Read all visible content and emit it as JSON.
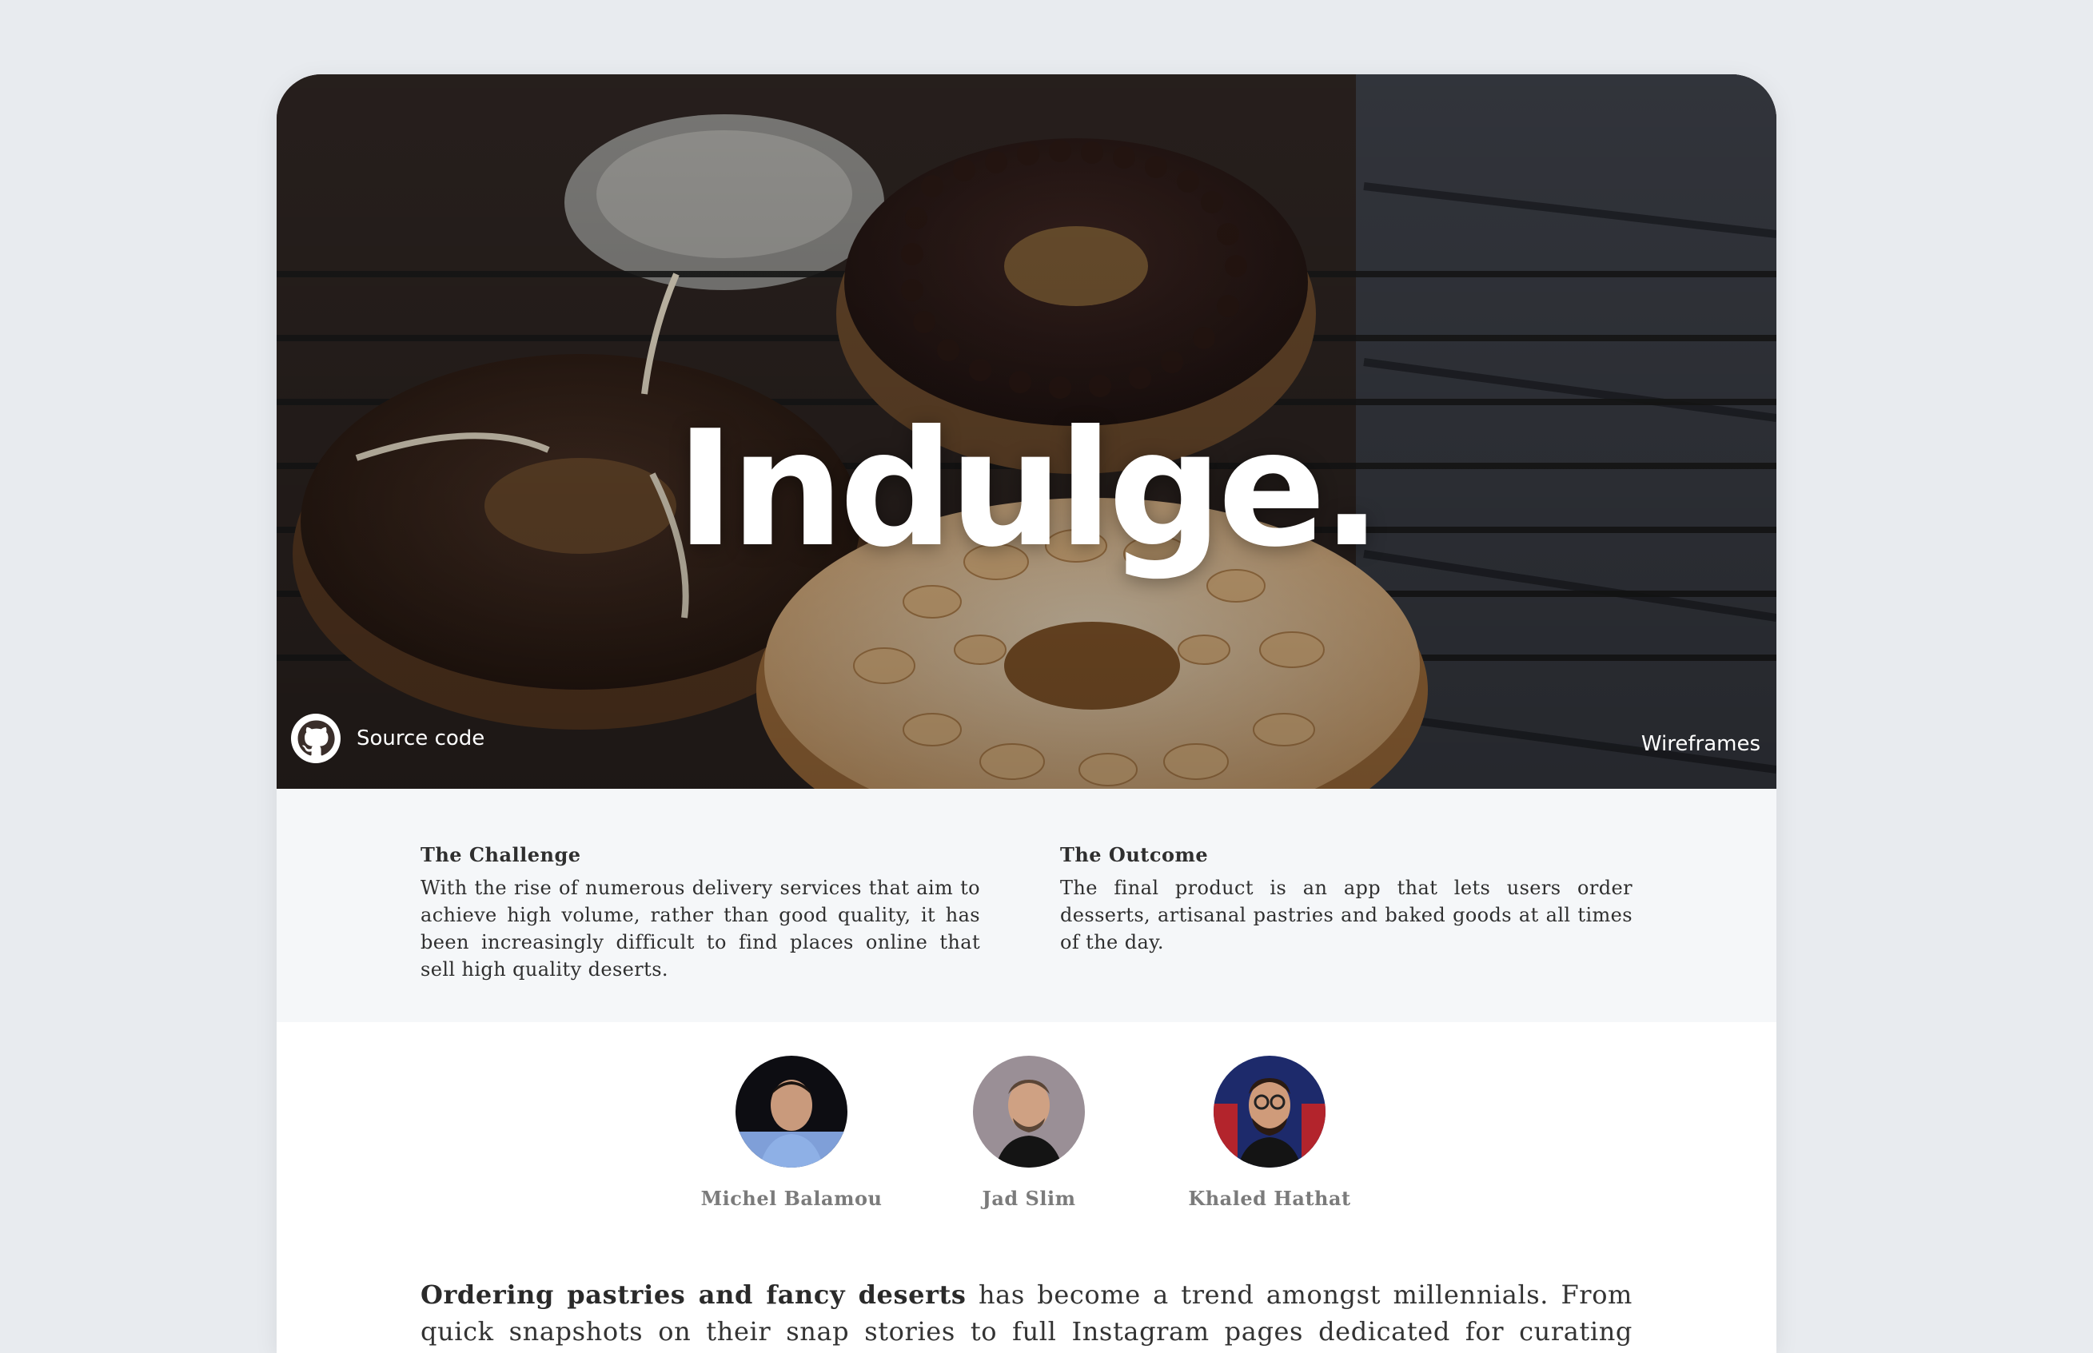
{
  "hero": {
    "title": "Indulge.",
    "source_label": "Source code",
    "wireframes_label": "Wireframes"
  },
  "challenge": {
    "heading": "The Challenge",
    "text": "With the rise of numerous delivery services that aim to achieve high volume, rather than good quality, it has been increasingly difficult to find places online that sell high quality deserts."
  },
  "outcome": {
    "heading": "The Outcome",
    "text": "The final product is an app that lets users order desserts, artisanal pastries and baked goods at all times of the day."
  },
  "team": [
    {
      "name": "Michel Balamou",
      "icon": "avatar-photo"
    },
    {
      "name": "Jad Slim",
      "icon": "avatar-photo"
    },
    {
      "name": "Khaled Hathat",
      "icon": "avatar-photo"
    }
  ],
  "intro": {
    "lead": "Ordering pastries and fancy deserts",
    "rest": " has become a trend amongst millennials. From quick snapshots on their snap stories to full Instagram pages dedicated for curating deserts; millennials are"
  },
  "colors": {
    "page_bg": "#e8ebef",
    "info_bg": "#f5f7f9",
    "text": "#2f2f2f",
    "muted": "#7b7b7b"
  }
}
